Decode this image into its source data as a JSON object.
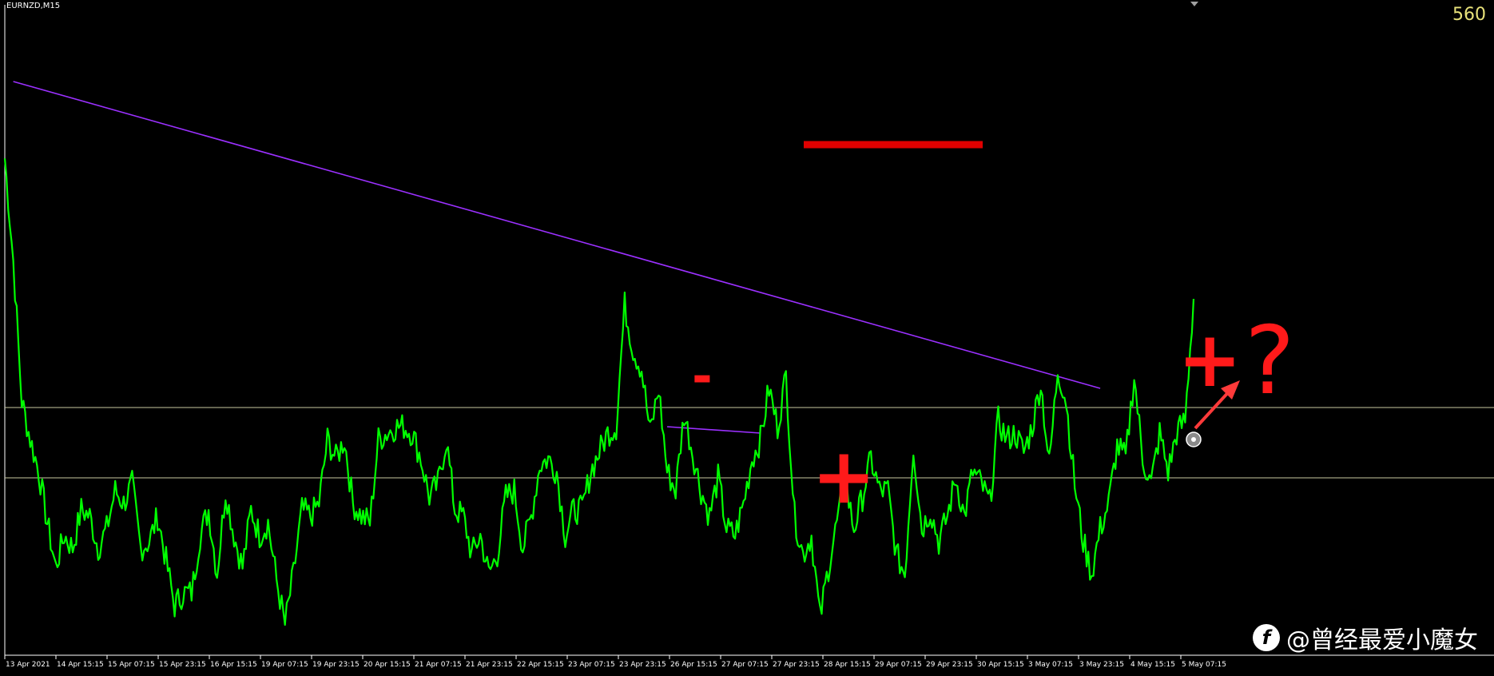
{
  "chart_header": {
    "symbol": "EURNZD,M15",
    "price_label": "560"
  },
  "annotations": {
    "minus": "-",
    "plus_1": "+",
    "plus_2": "+",
    "question": "?"
  },
  "watermark": {
    "text": "@曾经最爱小魔女",
    "logo_icon": "toutiao-logo-icon"
  },
  "colors": {
    "background": "#000000",
    "price_line": "#00ff00",
    "trendline": "#9b30ff",
    "level_line": "#c8c8a0",
    "annotation": "#ff1a1a",
    "axis_text": "#ffffff"
  },
  "chart_data": {
    "type": "line",
    "series": [
      {
        "values": [
          0.76,
          0.6,
          0.38,
          0.32,
          0.27,
          0.19,
          0.12,
          0.17,
          0.15,
          0.21,
          0.2,
          0.15,
          0.18,
          0.24,
          0.22,
          0.25,
          0.15,
          0.16,
          0.2,
          0.13,
          0.06,
          0.08,
          0.08,
          0.17,
          0.21,
          0.11,
          0.24,
          0.17,
          0.12,
          0.21,
          0.17,
          0.19,
          0.1,
          0.03,
          0.11,
          0.21,
          0.2,
          0.22,
          0.32,
          0.29,
          0.32,
          0.22,
          0.2,
          0.19,
          0.32,
          0.33,
          0.34,
          0.34,
          0.33,
          0.29,
          0.23,
          0.25,
          0.32,
          0.21,
          0.2,
          0.14,
          0.17,
          0.11,
          0.14,
          0.23,
          0.24,
          0.15,
          0.2,
          0.28,
          0.29,
          0.27,
          0.17,
          0.21,
          0.21,
          0.27,
          0.3,
          0.33,
          0.34,
          0.53,
          0.46,
          0.43,
          0.33,
          0.4,
          0.27,
          0.24,
          0.36,
          0.3,
          0.24,
          0.2,
          0.26,
          0.18,
          0.17,
          0.22,
          0.29,
          0.32,
          0.4,
          0.34,
          0.42,
          0.2,
          0.14,
          0.17,
          0.04,
          0.12,
          0.19,
          0.25,
          0.18,
          0.23,
          0.29,
          0.24,
          0.24,
          0.14,
          0.11,
          0.31,
          0.18,
          0.21,
          0.16,
          0.2,
          0.26,
          0.2,
          0.27,
          0.25,
          0.22,
          0.35,
          0.32,
          0.33,
          0.3,
          0.34,
          0.41,
          0.28,
          0.43,
          0.38,
          0.25,
          0.16,
          0.11,
          0.18,
          0.22,
          0.31,
          0.29,
          0.42,
          0.29,
          0.25,
          0.33,
          0.27,
          0.33,
          0.35,
          0.54
        ]
      }
    ],
    "x_tick_labels": [
      "13 Apr 2021",
      "14 Apr 15:15",
      "15 Apr 07:15",
      "15 Apr 23:15",
      "16 Apr 15:15",
      "19 Apr 07:15",
      "19 Apr 23:15",
      "20 Apr 15:15",
      "21 Apr 07:15",
      "21 Apr 23:15",
      "22 Apr 15:15",
      "23 Apr 07:15",
      "23 Apr 23:15",
      "26 Apr 15:15",
      "27 Apr 07:15",
      "27 Apr 23:15",
      "28 Apr 15:15",
      "29 Apr 07:15",
      "29 Apr 23:15",
      "30 Apr 15:15",
      "3 May 07:15",
      "3 May 23:15",
      "4 May 15:15",
      "5 May 07:15"
    ],
    "horizontal_levels": [
      0.37,
      0.26
    ],
    "trendlines": [
      {
        "from": [
          1,
          0.88
        ],
        "to": [
          129,
          0.4
        ]
      },
      {
        "from": [
          78,
          0.34
        ],
        "to": [
          89,
          0.33
        ]
      }
    ],
    "grid": false,
    "legend": "none"
  }
}
